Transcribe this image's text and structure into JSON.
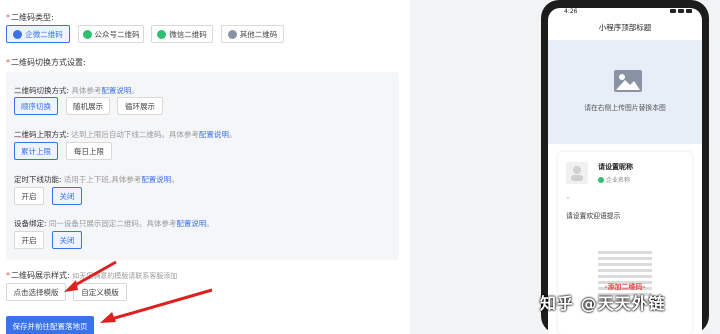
{
  "qr_type": {
    "label": "二维码类型:",
    "options": [
      {
        "label": "企微二维码",
        "active": true
      },
      {
        "label": "公众号二维码",
        "active": false
      },
      {
        "label": "微信二维码",
        "active": false
      },
      {
        "label": "其他二维码",
        "active": false
      }
    ]
  },
  "switch_settings": {
    "label": "二维码切换方式设置:",
    "method": {
      "title": "二维码切换方式:",
      "hint": "具体参考",
      "link": "配置说明",
      "end": "。",
      "options": [
        "顺序切换",
        "随机展示",
        "循环展示"
      ]
    },
    "limit": {
      "title": "二维码上限方式:",
      "hint": "达到上限后自动下线二维码。具体参考",
      "link": "配置说明",
      "end": "。",
      "options": [
        "累计上限",
        "每日上限"
      ]
    },
    "timing": {
      "title": "定时下线功能:",
      "hint": "适用于上下班,具体参考",
      "link": "配置说明",
      "end": "。",
      "options": [
        "开启",
        "关闭"
      ]
    },
    "device": {
      "title": "设备绑定:",
      "hint": "同一设备只展示固定二维码。具体参考",
      "link": "配置说明",
      "end": "。",
      "options": [
        "开启",
        "关闭"
      ]
    }
  },
  "display_style": {
    "label": "二维码展示样式:",
    "hint": "如无您满意的模版请联系客服添加",
    "options": [
      "点击选择模版",
      "自定义模版"
    ]
  },
  "save_button": "保存并前往配置落地页",
  "colors": {
    "accent": "#3a72e8",
    "required": "#e84a4a",
    "arrow": "#e02020"
  },
  "phone": {
    "time": "4:26",
    "page_title": "小程序顶部标题",
    "banner_hint": "请在右侧上传图片替换本图",
    "nickname": "请设置昵称",
    "corp_name": "企业名称",
    "quote_mark": "“",
    "welcome": "请设置欢迎语提示",
    "qr_label": "-添加二维码-"
  },
  "watermark": "知乎 @天天外链"
}
